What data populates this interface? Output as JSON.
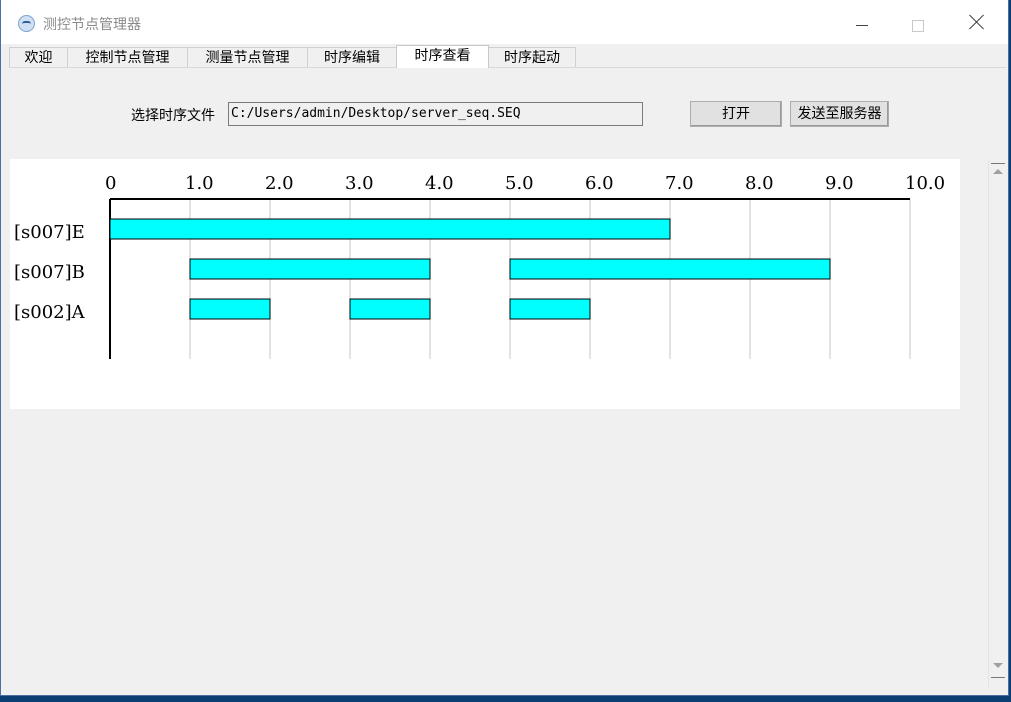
{
  "window": {
    "title": "测控节点管理器"
  },
  "tabs": [
    {
      "label": "欢迎"
    },
    {
      "label": "控制节点管理"
    },
    {
      "label": "测量节点管理"
    },
    {
      "label": "时序编辑"
    },
    {
      "label": "时序查看"
    },
    {
      "label": "时序起动"
    }
  ],
  "active_tab": "时序查看",
  "file": {
    "label": "选择时序文件",
    "path": "C:/Users/admin/Desktop/server_seq.SEQ",
    "open_button": "打开",
    "send_button": "发送至服务器"
  },
  "icons": {
    "app": "app-icon",
    "min": "minimize-icon",
    "max": "maximize-icon",
    "close": "close-icon"
  },
  "colors": {
    "bar": "#00ffff",
    "grid": "#c8c8c8",
    "axis": "#000000"
  },
  "chart_data": {
    "type": "bar",
    "orientation": "horizontal-gantt",
    "x_ticks": [
      "0",
      "1.0",
      "2.0",
      "3.0",
      "4.0",
      "5.0",
      "6.0",
      "7.0",
      "8.0",
      "9.0",
      "10.0"
    ],
    "xlim": [
      0,
      10
    ],
    "grid": true,
    "rows": [
      {
        "label": "[s007]E",
        "segments": [
          [
            0,
            7
          ]
        ]
      },
      {
        "label": "[s007]B",
        "segments": [
          [
            1,
            4
          ],
          [
            5,
            9
          ]
        ]
      },
      {
        "label": "[s002]A",
        "segments": [
          [
            1,
            2
          ],
          [
            3,
            4
          ],
          [
            5,
            6
          ]
        ]
      }
    ]
  }
}
